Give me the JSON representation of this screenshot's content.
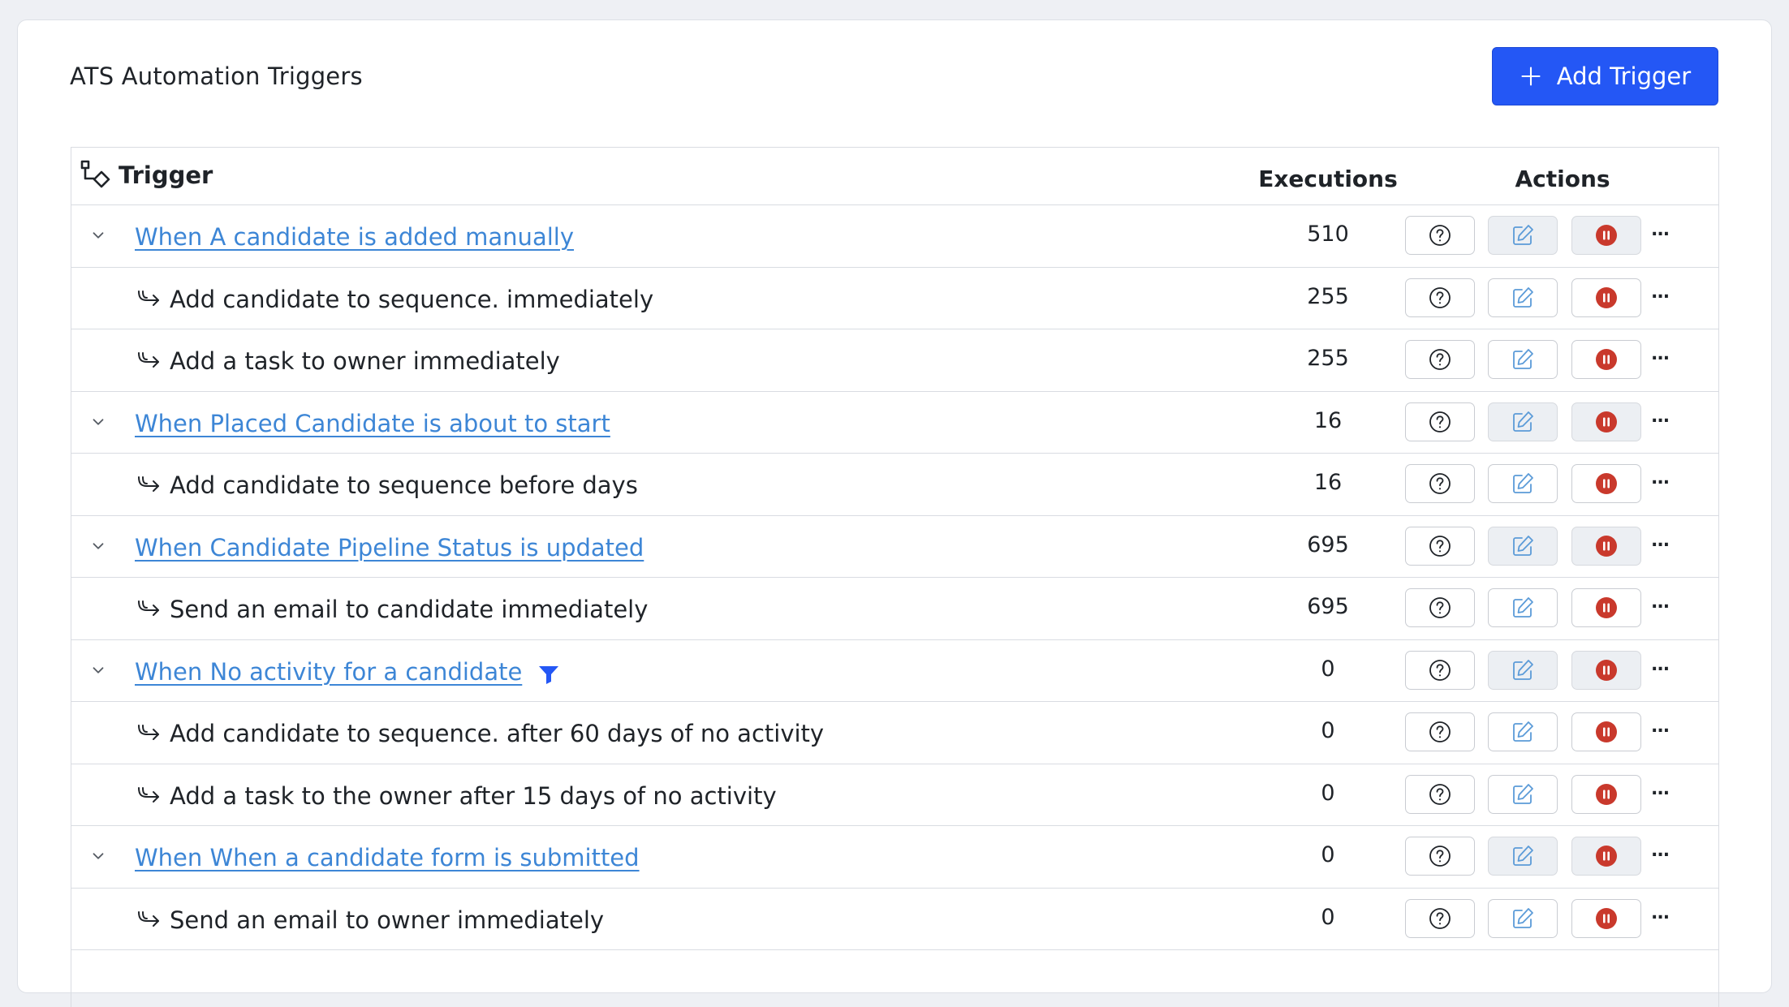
{
  "header": {
    "title": "ATS Automation Triggers",
    "add_button_label": "Add Trigger"
  },
  "table": {
    "columns": {
      "trigger": "Trigger",
      "executions": "Executions",
      "actions": "Actions"
    },
    "more_label": "...",
    "rows": [
      {
        "type": "parent",
        "label": "When A candidate is added manually",
        "executions": "510",
        "has_filter": false
      },
      {
        "type": "child",
        "label": "Add candidate to sequence. immediately",
        "executions": "255"
      },
      {
        "type": "child",
        "label": "Add a task to owner immediately",
        "executions": "255"
      },
      {
        "type": "parent",
        "label": "When Placed Candidate is about to start",
        "executions": "16",
        "has_filter": false
      },
      {
        "type": "child",
        "label": "Add candidate to sequence before days",
        "executions": "16"
      },
      {
        "type": "parent",
        "label": "When Candidate Pipeline Status is updated",
        "executions": "695",
        "has_filter": false
      },
      {
        "type": "child",
        "label": "Send an email to candidate immediately",
        "executions": "695"
      },
      {
        "type": "parent",
        "label": "When No activity for a candidate",
        "executions": "0",
        "has_filter": true
      },
      {
        "type": "child",
        "label": "Add candidate to sequence. after 60 days of no activity",
        "executions": "0"
      },
      {
        "type": "child",
        "label": "Add a task to the owner after 15 days of no activity",
        "executions": "0"
      },
      {
        "type": "parent",
        "label": "When When a candidate form is submitted",
        "executions": "0",
        "has_filter": false
      },
      {
        "type": "child",
        "label": "Send an email to owner immediately",
        "executions": "0"
      }
    ]
  },
  "colors": {
    "accent": "#2457f5",
    "link": "#3d86d6",
    "pause_red": "#c9392c",
    "edit_blue": "#5b9bd8"
  },
  "icons": {
    "header_trigger": "workflow-icon",
    "add": "plus-icon",
    "expand": "chevron-down-icon",
    "child": "arrow-return-right-icon",
    "filter": "filter-icon",
    "help": "question-circle-icon",
    "edit": "pencil-square-icon",
    "pause": "pause-circle-icon"
  }
}
